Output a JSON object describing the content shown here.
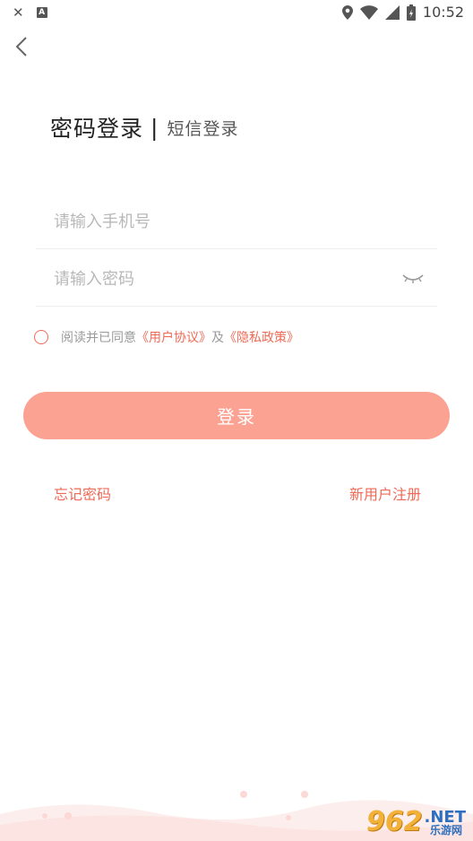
{
  "status_bar": {
    "left_icons": [
      "close-icon",
      "a-icon"
    ],
    "right_icons": [
      "location-icon",
      "wifi-icon",
      "signal-icon",
      "battery-icon"
    ],
    "time": "10:52"
  },
  "login_tabs": {
    "password": "密码登录",
    "separator": "|",
    "sms": "短信登录"
  },
  "phone_field": {
    "placeholder": "请输入手机号",
    "value": ""
  },
  "password_field": {
    "placeholder": "请输入密码",
    "value": ""
  },
  "agreement": {
    "prefix": "阅读并已同意",
    "user_agreement": "《用户协议》",
    "and": "及",
    "privacy_policy": "《隐私政策》"
  },
  "login_button": "登录",
  "forgot_password": "忘记密码",
  "register": "新用户注册",
  "watermark": {
    "number": "962",
    "domain": ".NET",
    "subtitle": "乐游网"
  },
  "colors": {
    "accent": "#ef6a56",
    "button": "#fba292"
  }
}
